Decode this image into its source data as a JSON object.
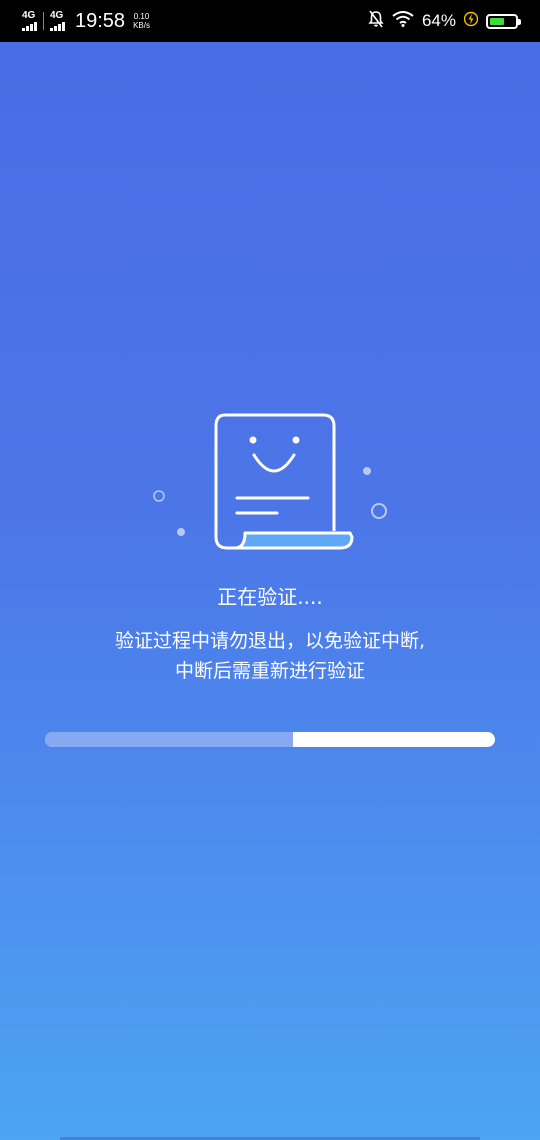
{
  "status_bar": {
    "network_1": "4G",
    "network_2": "4G",
    "time": "19:58",
    "speed_value": "0.10",
    "speed_unit": "KB/s",
    "battery_percent_text": "64%",
    "battery_level": 0.64,
    "icons": [
      "mute-bell-icon",
      "wifi-icon",
      "charging-bolt-icon",
      "battery-icon"
    ]
  },
  "verification": {
    "title": "正在验证....",
    "line1": "验证过程中请勿退出，以免验证中断,",
    "line2": "中断后需重新进行验证",
    "progress": 0.55
  },
  "colors": {
    "background_top": "#4a6be4",
    "background_bottom": "#4ca4f3",
    "progress_fill": "#86a9f2",
    "progress_track": "#ffffff",
    "illustration_accent": "#5fa8f5"
  }
}
